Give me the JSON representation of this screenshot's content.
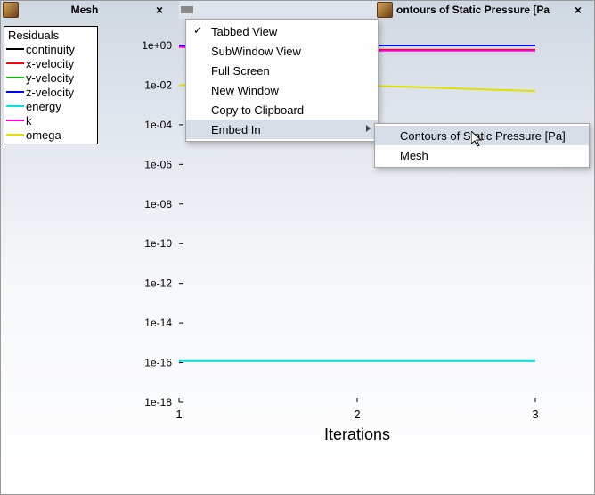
{
  "tabs": {
    "mesh": {
      "label": "Mesh",
      "close": "×"
    },
    "residuals": {
      "label": ""
    },
    "contours": {
      "label": "ontours of Static Pressure [Pa",
      "close": "×"
    }
  },
  "legend": {
    "title": "Residuals",
    "items": [
      {
        "label": "continuity",
        "color": "#000000"
      },
      {
        "label": "x-velocity",
        "color": "#ff0000"
      },
      {
        "label": "y-velocity",
        "color": "#00c000"
      },
      {
        "label": "z-velocity",
        "color": "#0000ff"
      },
      {
        "label": "energy",
        "color": "#00e0e0"
      },
      {
        "label": "k",
        "color": "#ff00d0"
      },
      {
        "label": "omega",
        "color": "#e0e000"
      }
    ]
  },
  "context_menu": {
    "items": [
      {
        "label": "Tabbed View",
        "checked": true
      },
      {
        "label": "SubWindow View"
      },
      {
        "label": "Full Screen"
      },
      {
        "label": "New Window"
      },
      {
        "label": "Copy to Clipboard"
      },
      {
        "label": "Embed In",
        "submenu": true,
        "highlight": true
      }
    ],
    "submenu": [
      {
        "label": "Contours of Static Pressure [Pa]",
        "highlight": true
      },
      {
        "label": "Mesh"
      }
    ]
  },
  "chart_data": {
    "type": "line",
    "xlabel": "Iterations",
    "ylabel": "",
    "x_ticks": [
      1,
      2,
      3
    ],
    "y_ticks": [
      "1e+00",
      "1e-02",
      "1e-04",
      "1e-06",
      "1e-08",
      "1e-10",
      "1e-12",
      "1e-14",
      "1e-16",
      "1e-18"
    ],
    "y_scale": "log",
    "xlim": [
      1,
      3
    ],
    "ylim": [
      1e-18,
      1.0
    ],
    "series": [
      {
        "name": "continuity",
        "color": "#000000",
        "x": [
          1,
          2,
          3
        ],
        "y": [
          1.0,
          1.0,
          1.0
        ]
      },
      {
        "name": "x-velocity",
        "color": "#ff0000",
        "x": [
          1,
          2,
          3
        ],
        "y": [
          0.9,
          0.6,
          0.6
        ]
      },
      {
        "name": "y-velocity",
        "color": "#00c000",
        "x": [
          1,
          2,
          3
        ],
        "y": [
          1.0,
          1.0,
          1.0
        ]
      },
      {
        "name": "z-velocity",
        "color": "#0000ff",
        "x": [
          1,
          2,
          3
        ],
        "y": [
          1.0,
          1.0,
          1.0
        ]
      },
      {
        "name": "energy",
        "color": "#00e0e0",
        "x": [
          1,
          2,
          3
        ],
        "y": [
          1.2e-16,
          1.2e-16,
          1.2e-16
        ]
      },
      {
        "name": "k",
        "color": "#ff00d0",
        "x": [
          1,
          2,
          3
        ],
        "y": [
          0.85,
          0.55,
          0.55
        ]
      },
      {
        "name": "omega",
        "color": "#e0e000",
        "x": [
          1,
          2,
          3
        ],
        "y": [
          0.01,
          0.01,
          0.005
        ]
      }
    ]
  }
}
